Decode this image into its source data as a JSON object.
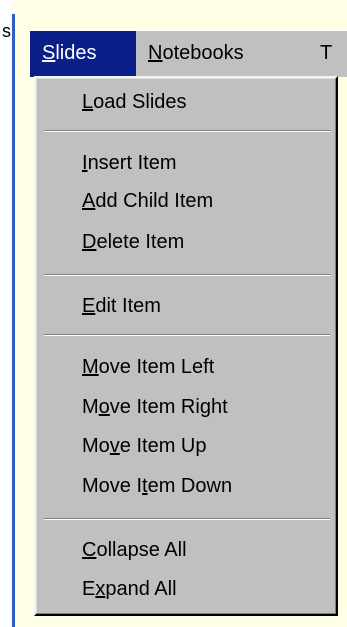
{
  "left_edge_text": "s",
  "menubar": {
    "items": [
      {
        "label": "Slides",
        "active": true
      },
      {
        "label": "Notebooks",
        "active": false
      },
      {
        "label": "T",
        "active": false
      }
    ]
  },
  "menu": {
    "items": [
      {
        "label": "Load Slides",
        "mnemonic": "L"
      },
      {
        "label": "Insert Item",
        "mnemonic": "I"
      },
      {
        "label": "Add Child Item",
        "mnemonic": "A"
      },
      {
        "label": "Delete Item",
        "mnemonic": "D"
      },
      {
        "label": "Edit Item",
        "mnemonic": "E"
      },
      {
        "label": "Move Item Left",
        "mnemonic": "M"
      },
      {
        "label": "Move Item Right",
        "mnemonic": "o"
      },
      {
        "label": "Move Item Up",
        "mnemonic": "v"
      },
      {
        "label": "Move Item Down",
        "mnemonic": "t"
      },
      {
        "label": "Collapse All",
        "mnemonic": "C"
      },
      {
        "label": "Expand All",
        "mnemonic": "x"
      }
    ]
  },
  "colors": {
    "menu_bg": "#c0c0c0",
    "active_bg": "#0a1f8a",
    "active_text": "#ffffff",
    "border_blue": "#2b5fcc",
    "app_bg": "#ffffe6"
  }
}
